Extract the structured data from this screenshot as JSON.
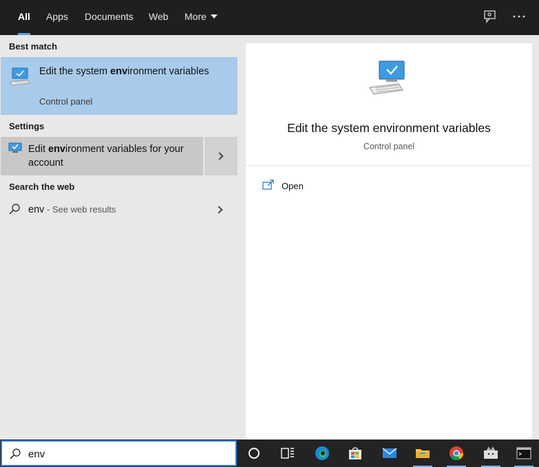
{
  "tabs": [
    {
      "label": "All",
      "active": true
    },
    {
      "label": "Apps"
    },
    {
      "label": "Documents"
    },
    {
      "label": "Web"
    },
    {
      "label": "More"
    }
  ],
  "header_icons": [
    "feedback-icon",
    "more-options-icon"
  ],
  "sections": {
    "best_match": "Best match",
    "settings": "Settings",
    "search_web": "Search the web"
  },
  "best_match": {
    "title_pre": "Edit the system ",
    "title_bold": "env",
    "title_post": "ironment variables",
    "subtitle": "Control panel",
    "icon": "monitor-check-icon"
  },
  "settings_item": {
    "title_pre": "Edit ",
    "title_bold": "env",
    "title_post": "ironment variables for your account",
    "icon": "settings-monitor-icon"
  },
  "web_item": {
    "query": "env",
    "hint": " - See web results",
    "icon": "search-icon"
  },
  "preview": {
    "title": "Edit the system environment variables",
    "subtitle": "Control panel",
    "open_label": "Open"
  },
  "search": {
    "value": "env"
  },
  "taskbar": [
    "cortana-icon",
    "task-view-icon",
    "edge-icon",
    "store-icon",
    "mail-icon",
    "file-explorer-icon",
    "chrome-icon",
    "app-icon",
    "terminal-icon"
  ],
  "colors": {
    "accent": "#2d7bd6",
    "selected": "#a9cbeb",
    "hover": "#c8c8c8"
  }
}
